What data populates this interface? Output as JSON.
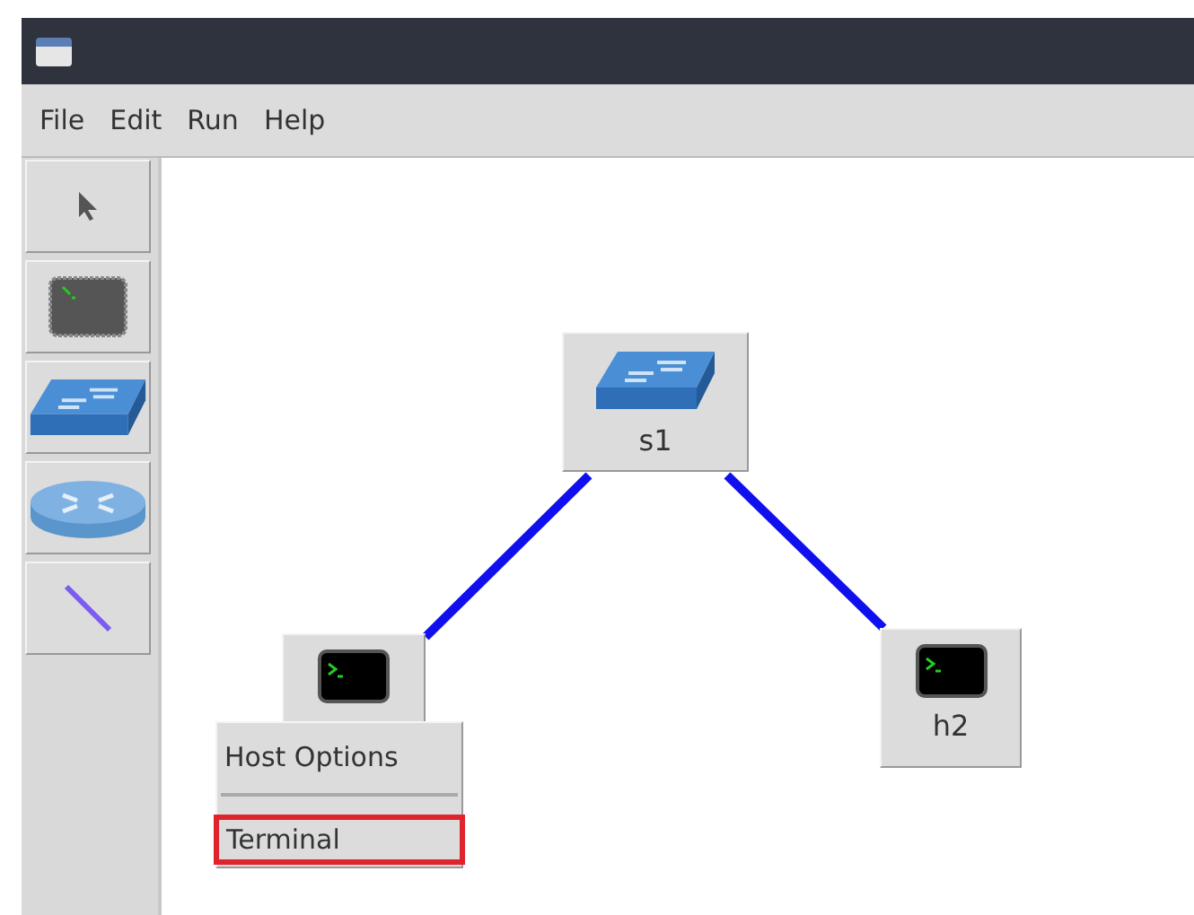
{
  "menu_bar": [
    "File",
    "Edit",
    "Run",
    "Help"
  ],
  "toolbar": [
    {
      "kind": "select"
    },
    {
      "kind": "host"
    },
    {
      "kind": "switch"
    },
    {
      "kind": "router"
    },
    {
      "kind": "link"
    }
  ],
  "canvas": {
    "nodes": [
      {
        "kind": "switch",
        "label": "s1"
      },
      {
        "kind": "host"
      },
      {
        "kind": "host",
        "label": "h2"
      }
    ],
    "context_menu": [
      {
        "kind": "item",
        "label": "Host Options",
        "selected": false
      },
      {
        "kind": "separator"
      },
      {
        "kind": "item",
        "label": "Terminal",
        "selected": true
      }
    ]
  }
}
